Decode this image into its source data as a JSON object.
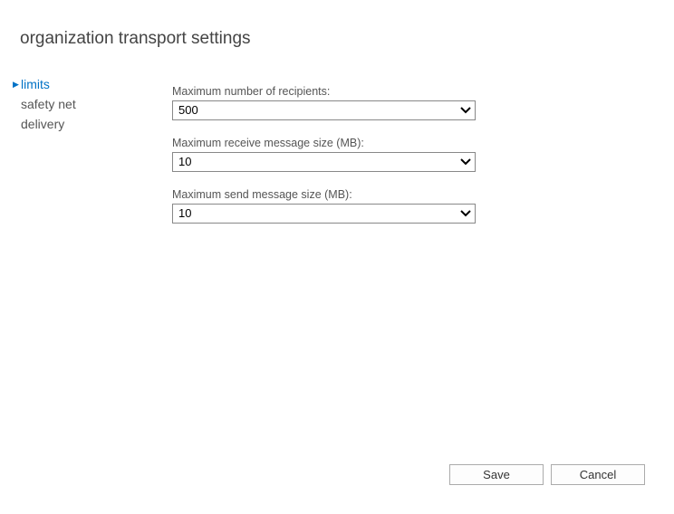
{
  "title": "organization transport settings",
  "sidebar": {
    "items": [
      {
        "label": "limits",
        "active": true
      },
      {
        "label": "safety net",
        "active": false
      },
      {
        "label": "delivery",
        "active": false
      }
    ]
  },
  "form": {
    "recipients": {
      "label": "Maximum number of recipients:",
      "value": "500"
    },
    "receive_size": {
      "label": "Maximum receive message size (MB):",
      "value": "10"
    },
    "send_size": {
      "label": "Maximum send message size (MB):",
      "value": "10"
    }
  },
  "buttons": {
    "save": "Save",
    "cancel": "Cancel"
  }
}
